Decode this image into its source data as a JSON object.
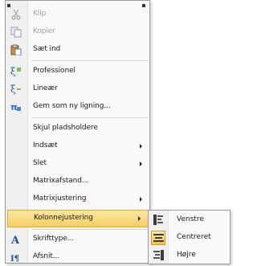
{
  "context_menu": {
    "items": [
      {
        "label": "Klip",
        "icon": "scissors-icon",
        "disabled": true
      },
      {
        "label": "Kopier",
        "icon": "copy-icon",
        "disabled": true
      },
      {
        "label": "Sæt ind",
        "icon": "paste-icon",
        "disabled": false
      },
      {
        "label": "Professionel",
        "icon": "equation-professional-icon",
        "disabled": false
      },
      {
        "label": "Lineær",
        "icon": "equation-linear-icon",
        "disabled": false
      },
      {
        "label": "Gem som ny ligning...",
        "icon": "save-equation-icon",
        "disabled": false
      },
      {
        "label": "Skjul pladsholdere",
        "icon": "",
        "disabled": false
      },
      {
        "label": "Indsæt",
        "icon": "",
        "disabled": false,
        "submenu": true
      },
      {
        "label": "Slet",
        "icon": "",
        "disabled": false,
        "submenu": true
      },
      {
        "label": "Matrixafstand...",
        "icon": "",
        "disabled": false
      },
      {
        "label": "Matrixjustering",
        "icon": "",
        "disabled": false,
        "submenu": true
      },
      {
        "label": "Kolonnejustering",
        "icon": "",
        "disabled": false,
        "submenu": true,
        "highlighted": true
      },
      {
        "label": "Skrifttype...",
        "icon": "font-icon",
        "disabled": false
      },
      {
        "label": "Afsnit...",
        "icon": "paragraph-icon",
        "disabled": false
      }
    ]
  },
  "column_alignment_submenu": {
    "items": [
      {
        "label": "Venstre",
        "icon": "align-left-icon"
      },
      {
        "label": "Centreret",
        "icon": "align-center-icon",
        "selected": true
      },
      {
        "label": "Højre",
        "icon": "align-right-icon"
      }
    ]
  },
  "colors": {
    "highlight": "#f7cf62",
    "highlight_border": "#d8a93d",
    "disabled_text": "#a0a0a0"
  }
}
